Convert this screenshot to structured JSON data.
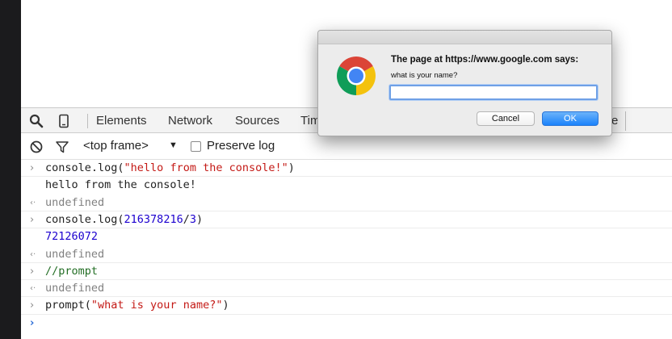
{
  "devtools": {
    "tabs": [
      "Elements",
      "Network",
      "Sources",
      "Tim",
      "e"
    ],
    "frame_select": "<top frame>",
    "preserve_log_label": "Preserve log",
    "preserve_log_checked": false
  },
  "console": {
    "lines": [
      {
        "kind": "input",
        "parts": [
          {
            "t": "console.log(",
            "c": "plain"
          },
          {
            "t": "\"hello from the console!\"",
            "c": "str"
          },
          {
            "t": ")",
            "c": "plain"
          }
        ]
      },
      {
        "kind": "output",
        "text": "hello from the console!"
      },
      {
        "kind": "result",
        "text": "undefined"
      },
      {
        "kind": "input",
        "parts": [
          {
            "t": "console.log(",
            "c": "plain"
          },
          {
            "t": "216378216",
            "c": "num"
          },
          {
            "t": "/",
            "c": "plain"
          },
          {
            "t": "3",
            "c": "num"
          },
          {
            "t": ")",
            "c": "plain"
          }
        ]
      },
      {
        "kind": "number",
        "text": "72126072"
      },
      {
        "kind": "result",
        "text": "undefined"
      },
      {
        "kind": "comment",
        "text": "//prompt"
      },
      {
        "kind": "result",
        "text": "undefined"
      },
      {
        "kind": "input",
        "parts": [
          {
            "t": "prompt(",
            "c": "plain"
          },
          {
            "t": "\"what is your name?\"",
            "c": "str"
          },
          {
            "t": ")",
            "c": "plain"
          }
        ]
      },
      {
        "kind": "prompt",
        "text": ""
      }
    ],
    "colors": {
      "string": "#c41a16",
      "number": "#1c00cf",
      "comment": "#236e25",
      "muted": "#808080"
    }
  },
  "dialog": {
    "title": "The page at https://www.google.com says:",
    "message": "what is your name?",
    "input_value": "",
    "cancel_label": "Cancel",
    "ok_label": "OK",
    "ok_color": "#1a82fb"
  }
}
